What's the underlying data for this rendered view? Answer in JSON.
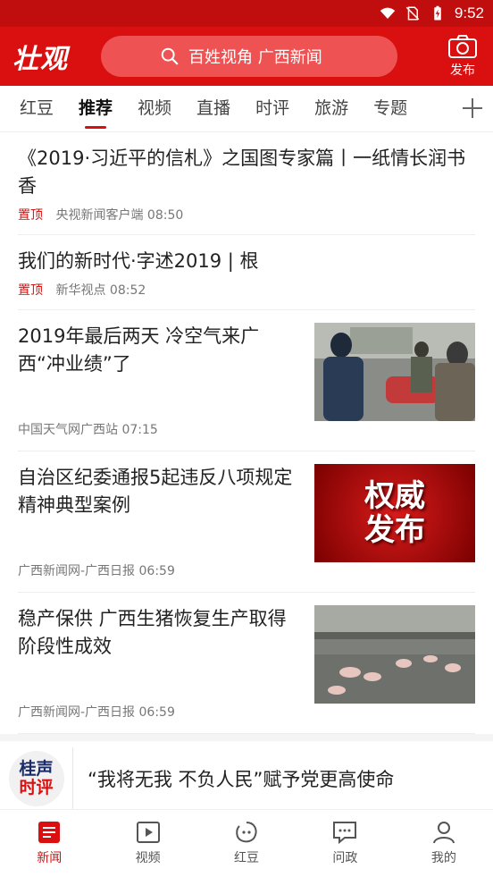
{
  "status_bar": {
    "time": "9:52",
    "icons": [
      "wifi-icon",
      "no-sim-icon",
      "battery-charging-icon"
    ]
  },
  "header": {
    "logo": "壮观",
    "search_placeholder": "百姓视角 广西新闻",
    "publish_label": "发布",
    "accent": "#d9100f"
  },
  "tabs": [
    "红豆",
    "推荐",
    "视频",
    "直播",
    "时评",
    "旅游",
    "专题"
  ],
  "active_tab": "推荐",
  "news": [
    {
      "title": "《2019·习近平的信札》之国图专家篇丨一纸情长润书香",
      "pin": "置顶",
      "source": "央视新闻客户端",
      "time": "08:50"
    },
    {
      "title": "我们的新时代·字述2019 | 根",
      "pin": "置顶",
      "source": "新华视点",
      "time": "08:52"
    },
    {
      "title": "2019年最后两天 冷空气来广西“冲业绩”了",
      "source": "中国天气网广西站",
      "time": "07:15",
      "image": "photo-people-in-cold"
    },
    {
      "title": "自治区纪委通报5起违反八项规定精神典型案例",
      "source": "广西新闻网-广西日报",
      "time": "06:59",
      "image": "authority-release-banner",
      "image_text": "权威\n发布"
    },
    {
      "title": "稳产保供 广西生猪恢复生产取得阶段性成效",
      "source": "广西新闻网-广西日报",
      "time": "06:59",
      "image": "photo-pig-farm"
    }
  ],
  "commentary": {
    "logo_line1": "桂声",
    "logo_line2": "时评",
    "text": "“我将无我 不负人民”赋予党更高使命"
  },
  "bottom_nav": [
    {
      "label": "新闻",
      "icon": "news-icon",
      "active": true
    },
    {
      "label": "视频",
      "icon": "video-icon",
      "active": false
    },
    {
      "label": "红豆",
      "icon": "red-bean-icon",
      "active": false
    },
    {
      "label": "问政",
      "icon": "message-icon",
      "active": false
    },
    {
      "label": "我的",
      "icon": "profile-icon",
      "active": false
    }
  ]
}
